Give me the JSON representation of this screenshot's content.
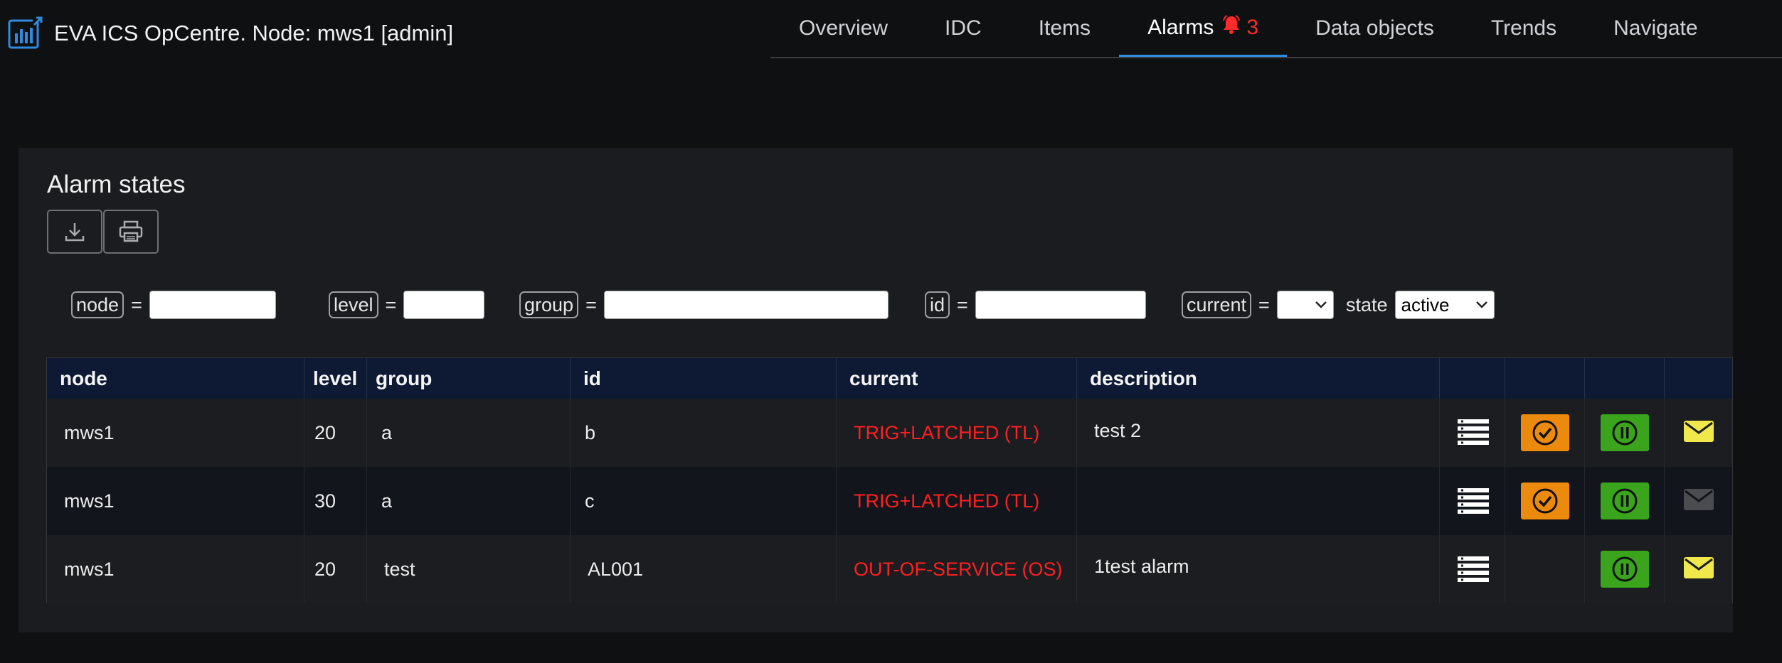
{
  "app": {
    "title": "EVA ICS OpCentre. Node: mws1 [admin]"
  },
  "nav": {
    "tabs": [
      {
        "label": "Overview"
      },
      {
        "label": "IDC"
      },
      {
        "label": "Items"
      },
      {
        "label": "Alarms",
        "badge_icon": "bell-icon",
        "badge_count": "3",
        "active": true
      },
      {
        "label": "Data objects"
      },
      {
        "label": "Trends"
      },
      {
        "label": "Navigate"
      }
    ]
  },
  "panel": {
    "title": "Alarm states",
    "tools": [
      {
        "icon": "download-icon"
      },
      {
        "icon": "printer-icon"
      }
    ]
  },
  "filters": {
    "node": {
      "label": "node",
      "value": ""
    },
    "level": {
      "label": "level",
      "value": ""
    },
    "group": {
      "label": "group",
      "value": ""
    },
    "id": {
      "label": "id",
      "value": ""
    },
    "current": {
      "label": "current",
      "value": ""
    },
    "state": {
      "label": "state",
      "value": "active"
    },
    "eq": "="
  },
  "table": {
    "headers": {
      "node": "node",
      "level": "level",
      "group": "group",
      "id": "id",
      "current": "current",
      "description": "description"
    },
    "rows": [
      {
        "node": "mws1",
        "level": "20",
        "group": "a",
        "id": "b",
        "current": "TRIG+LATCHED (TL)",
        "description": "test 2",
        "has_ack": true,
        "mail_active": true
      },
      {
        "node": "mws1",
        "level": "30",
        "group": "a",
        "id": "c",
        "current": "TRIG+LATCHED (TL)",
        "description": "",
        "has_ack": true,
        "mail_active": false
      },
      {
        "node": "mws1",
        "level": "20",
        "group": "test",
        "id": "AL001",
        "current": "OUT-OF-SERVICE (OS)",
        "description": "1test alarm",
        "has_ack": false,
        "mail_active": true
      }
    ]
  },
  "colors": {
    "accent": "#2f8ae0",
    "alarm": "#ff1f1f",
    "ack_button": "#ec8a0d",
    "shelve_button": "#3aa51c",
    "mail_active": "#f1e84b",
    "mail_inactive": "#4a4c50",
    "header_bg": "#0e1a34"
  }
}
